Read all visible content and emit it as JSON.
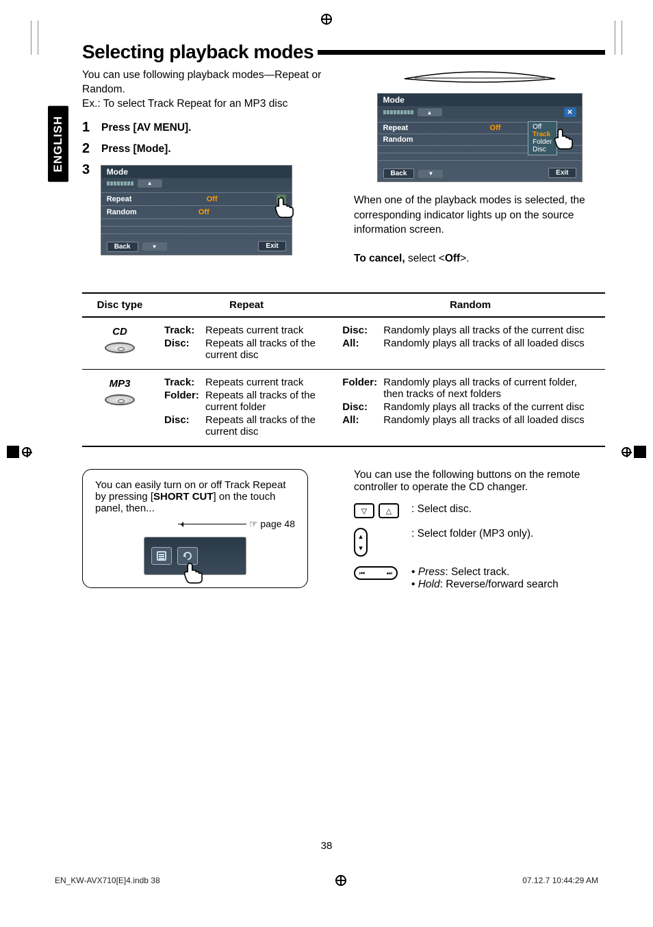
{
  "language_tab": "ENGLISH",
  "title": "Selecting playback modes",
  "intro_line1": "You can use following playback modes—Repeat or Random.",
  "intro_line2": "Ex.: To select Track Repeat for an MP3 disc",
  "steps": {
    "s1": "Press [AV MENU].",
    "s2": "Press [Mode].",
    "s3": ""
  },
  "panel1": {
    "title": "Mode",
    "row1_label": "Repeat",
    "row1_value": "Off",
    "row2_label": "Random",
    "row2_value": "Off",
    "back": "Back",
    "exit": "Exit"
  },
  "panel2": {
    "title": "Mode",
    "row1_label": "Repeat",
    "row1_value": "Off",
    "row2_label": "Random",
    "dropdown": {
      "opt1": "Off",
      "opt2": "Track",
      "opt3": "Folder",
      "opt4": "Disc"
    },
    "back": "Back",
    "exit": "Exit"
  },
  "selected_text": "When one of the playback modes is selected, the corresponding indicator lights up on the source information screen.",
  "cancel_label": "To cancel,",
  "cancel_rest": " select <",
  "cancel_off": "Off",
  "cancel_end": ">.",
  "table": {
    "h1": "Disc type",
    "h2": "Repeat",
    "h3": "Random",
    "cd_label": "CD",
    "mp3_label": "MP3",
    "cd_repeat": {
      "k1": "Track:",
      "v1": "Repeats current track",
      "k2": "Disc:",
      "v2": "Repeats all tracks of the current disc"
    },
    "cd_random": {
      "k1": "Disc:",
      "v1": "Randomly plays all tracks of the current disc",
      "k2": "All:",
      "v2": "Randomly plays all tracks of all loaded discs"
    },
    "mp3_repeat": {
      "k1": "Track:",
      "v1": "Repeats current track",
      "k2": "Folder:",
      "v2": "Repeats all tracks of the current folder",
      "k3": "Disc:",
      "v3": "Repeats all tracks of the current disc"
    },
    "mp3_random": {
      "k1": "Folder:",
      "v1": "Randomly plays all tracks of current folder, then tracks of next folders",
      "k2": "Disc:",
      "v2": "Randomly plays all tracks of the current disc",
      "k3": "All:",
      "v3": "Randomly plays all tracks of all loaded discs"
    }
  },
  "shortcut": {
    "text1": "You can easily turn on or off Track Repeat by pressing [",
    "bold": "SHORT CUT",
    "text2": "] on the touch panel, then...",
    "page_ref": "☞ page 48"
  },
  "remote": {
    "intro": "You can use the following buttons on the remote controller to operate the CD changer.",
    "r1": "Select disc.",
    "r2": "Select folder (MP3 only).",
    "r3a_i": "Press",
    "r3a": ": Select track.",
    "r3b_i": "Hold",
    "r3b": ": Reverse/forward search"
  },
  "page_num": "38",
  "footer_file": "EN_KW-AVX710[E]4.indb   38",
  "footer_time": "07.12.7   10:44:29 AM"
}
